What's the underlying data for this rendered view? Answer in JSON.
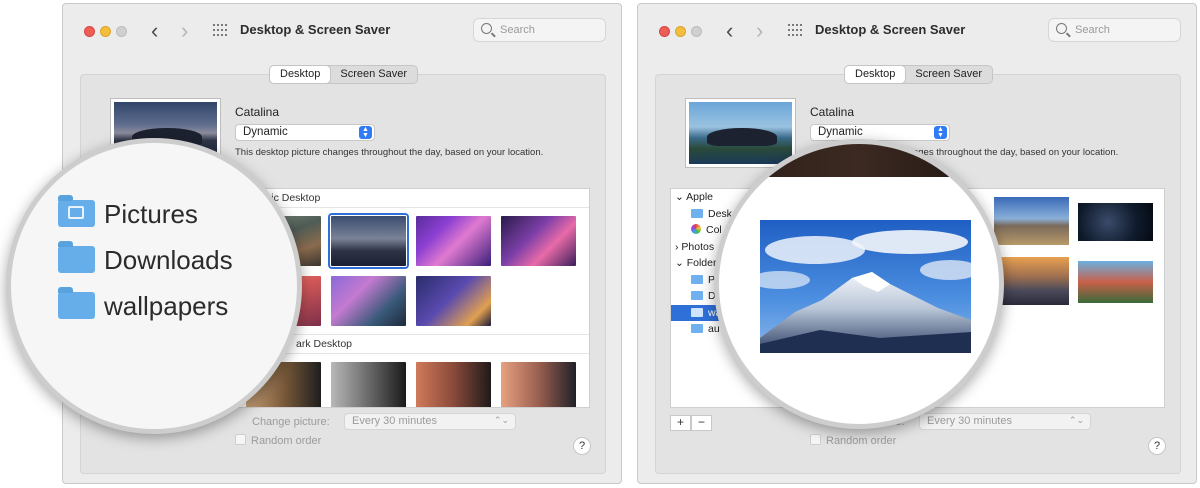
{
  "window": {
    "title": "Desktop & Screen Saver",
    "search_placeholder": "Search",
    "tabs": [
      "Desktop",
      "Screen Saver"
    ],
    "active_tab": "Desktop"
  },
  "current_picture": {
    "name": "Catalina",
    "mode": "Dynamic",
    "description": "This desktop picture changes throughout the day, based on your location."
  },
  "sections": {
    "dynamic": "Dynamic Desktop",
    "light_dark": "ark Desktop"
  },
  "options": {
    "change_picture_label": "Change picture:",
    "change_picture_value": "Every 30 minutes",
    "random_order_label": "Random order",
    "help": "?"
  },
  "sidebar": {
    "apple": "Apple",
    "desktop_partial": "Desk",
    "colors_partial": "Col",
    "photos_partial": "Photos",
    "folders_partial": "Folder",
    "f1_partial": "P",
    "f2_partial": "D",
    "f3_partial": "wa",
    "f4_partial": "au",
    "add": "+",
    "remove": "−"
  },
  "magnifier_left": {
    "items": [
      "Pictures",
      "Downloads",
      "wallpapers"
    ]
  },
  "colors": {
    "accent": "#2f6fd8",
    "window_bg": "#ececec",
    "folder": "#66aeea"
  }
}
